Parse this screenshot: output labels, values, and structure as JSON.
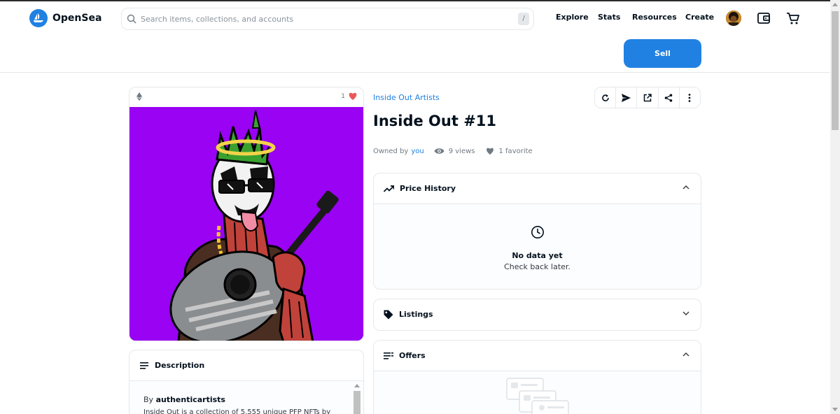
{
  "header": {
    "logo_text": "OpenSea",
    "search_placeholder": "Search items, collections, and accounts",
    "search_shortcut": "/",
    "nav": [
      "Explore",
      "Stats",
      "Resources",
      "Create"
    ],
    "icons": [
      "search-icon",
      "wallet-icon",
      "cart-icon",
      "avatar"
    ]
  },
  "sell": {
    "label": "Sell"
  },
  "item": {
    "collection": "Inside Out Artists",
    "title": "Inside Out #11",
    "owned_by_label": "Owned by",
    "owner": "you",
    "views": "9 views",
    "favorites": "1 favorite",
    "favorite_count": "1"
  },
  "actions": [
    "refresh-icon",
    "send-icon",
    "external-link-icon",
    "share-icon",
    "more-icon"
  ],
  "panels": {
    "price_history": {
      "title": "Price History",
      "empty_title": "No data yet",
      "empty_sub": "Check back later."
    },
    "listings": {
      "title": "Listings"
    },
    "offers": {
      "title": "Offers"
    }
  },
  "description": {
    "title": "Description",
    "by_label": "By",
    "creator": "authenticartists",
    "text": "Inside Out is a collection of 5,555 unique PFP NFTs by"
  },
  "colors": {
    "accent": "#2081e2",
    "image_bg": "#9902f2",
    "heart": "#eb5757"
  }
}
